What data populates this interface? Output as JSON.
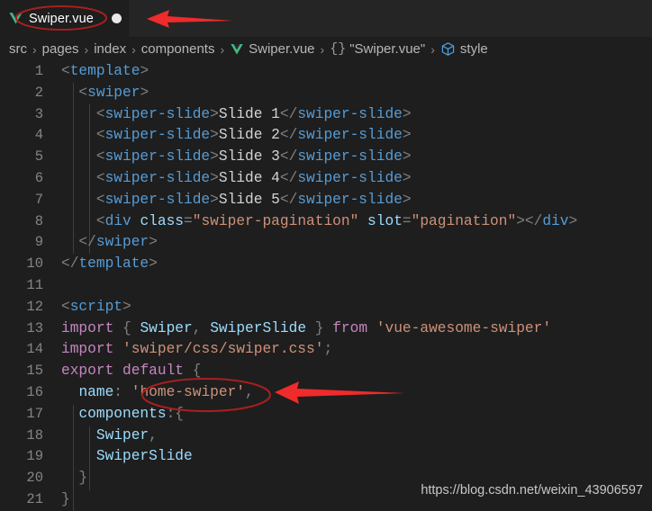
{
  "window": {
    "app": "Visual Studio Code",
    "theme_bg": "#1e1e1e",
    "tabbar_bg": "#252526"
  },
  "tabbar": {
    "tabs": [
      {
        "label": "Swiper.vue",
        "icon": "vue-icon",
        "dirty": true,
        "active": true
      }
    ]
  },
  "breadcrumb": {
    "separator": "›",
    "items": [
      {
        "label": "src",
        "icon": null
      },
      {
        "label": "pages",
        "icon": null
      },
      {
        "label": "index",
        "icon": null
      },
      {
        "label": "components",
        "icon": null
      },
      {
        "label": "Swiper.vue",
        "icon": "vue-icon"
      },
      {
        "label": "\"Swiper.vue\"",
        "icon": "braces-icon",
        "braces": "{}"
      },
      {
        "label": "style",
        "icon": "cube-icon"
      }
    ]
  },
  "editor": {
    "language": "vue",
    "first_line": 1,
    "lines": [
      {
        "n": "1",
        "tokens": [
          {
            "text": "<",
            "cls": "t-punct"
          },
          {
            "text": "template",
            "cls": "t-tag"
          },
          {
            "text": ">",
            "cls": "t-punct"
          }
        ]
      },
      {
        "n": "2",
        "tokens": [
          {
            "text": "  <",
            "cls": "t-punct"
          },
          {
            "text": "swiper",
            "cls": "t-tag"
          },
          {
            "text": ">",
            "cls": "t-punct"
          }
        ]
      },
      {
        "n": "3",
        "tokens": [
          {
            "text": "    <",
            "cls": "t-punct"
          },
          {
            "text": "swiper-slide",
            "cls": "t-tag"
          },
          {
            "text": ">",
            "cls": "t-punct"
          },
          {
            "text": "Slide 1",
            "cls": "t-text"
          },
          {
            "text": "</",
            "cls": "t-punct"
          },
          {
            "text": "swiper-slide",
            "cls": "t-tag"
          },
          {
            "text": ">",
            "cls": "t-punct"
          }
        ]
      },
      {
        "n": "4",
        "tokens": [
          {
            "text": "    <",
            "cls": "t-punct"
          },
          {
            "text": "swiper-slide",
            "cls": "t-tag"
          },
          {
            "text": ">",
            "cls": "t-punct"
          },
          {
            "text": "Slide 2",
            "cls": "t-text"
          },
          {
            "text": "</",
            "cls": "t-punct"
          },
          {
            "text": "swiper-slide",
            "cls": "t-tag"
          },
          {
            "text": ">",
            "cls": "t-punct"
          }
        ]
      },
      {
        "n": "5",
        "tokens": [
          {
            "text": "    <",
            "cls": "t-punct"
          },
          {
            "text": "swiper-slide",
            "cls": "t-tag"
          },
          {
            "text": ">",
            "cls": "t-punct"
          },
          {
            "text": "Slide 3",
            "cls": "t-text"
          },
          {
            "text": "</",
            "cls": "t-punct"
          },
          {
            "text": "swiper-slide",
            "cls": "t-tag"
          },
          {
            "text": ">",
            "cls": "t-punct"
          }
        ]
      },
      {
        "n": "6",
        "tokens": [
          {
            "text": "    <",
            "cls": "t-punct"
          },
          {
            "text": "swiper-slide",
            "cls": "t-tag"
          },
          {
            "text": ">",
            "cls": "t-punct"
          },
          {
            "text": "Slide 4",
            "cls": "t-text"
          },
          {
            "text": "</",
            "cls": "t-punct"
          },
          {
            "text": "swiper-slide",
            "cls": "t-tag"
          },
          {
            "text": ">",
            "cls": "t-punct"
          }
        ]
      },
      {
        "n": "7",
        "tokens": [
          {
            "text": "    <",
            "cls": "t-punct"
          },
          {
            "text": "swiper-slide",
            "cls": "t-tag"
          },
          {
            "text": ">",
            "cls": "t-punct"
          },
          {
            "text": "Slide 5",
            "cls": "t-text"
          },
          {
            "text": "</",
            "cls": "t-punct"
          },
          {
            "text": "swiper-slide",
            "cls": "t-tag"
          },
          {
            "text": ">",
            "cls": "t-punct"
          }
        ]
      },
      {
        "n": "8",
        "tokens": [
          {
            "text": "    <",
            "cls": "t-punct"
          },
          {
            "text": "div",
            "cls": "t-tag"
          },
          {
            "text": " ",
            "cls": "t-plain"
          },
          {
            "text": "class",
            "cls": "t-attr"
          },
          {
            "text": "=",
            "cls": "t-punct"
          },
          {
            "text": "\"swiper-pagination\"",
            "cls": "t-str"
          },
          {
            "text": " ",
            "cls": "t-plain"
          },
          {
            "text": "slot",
            "cls": "t-attr"
          },
          {
            "text": "=",
            "cls": "t-punct"
          },
          {
            "text": "\"pagination\"",
            "cls": "t-str"
          },
          {
            "text": ">",
            "cls": "t-punct"
          },
          {
            "text": "</",
            "cls": "t-punct"
          },
          {
            "text": "div",
            "cls": "t-tag"
          },
          {
            "text": ">",
            "cls": "t-punct"
          }
        ]
      },
      {
        "n": "9",
        "tokens": [
          {
            "text": "  </",
            "cls": "t-punct"
          },
          {
            "text": "swiper",
            "cls": "t-tag"
          },
          {
            "text": ">",
            "cls": "t-punct"
          }
        ]
      },
      {
        "n": "10",
        "tokens": [
          {
            "text": "</",
            "cls": "t-punct"
          },
          {
            "text": "template",
            "cls": "t-tag"
          },
          {
            "text": ">",
            "cls": "t-punct"
          }
        ]
      },
      {
        "n": "11",
        "tokens": []
      },
      {
        "n": "12",
        "tokens": [
          {
            "text": "<",
            "cls": "t-punct"
          },
          {
            "text": "script",
            "cls": "t-tag"
          },
          {
            "text": ">",
            "cls": "t-punct"
          }
        ]
      },
      {
        "n": "13",
        "tokens": [
          {
            "text": "import",
            "cls": "t-kw"
          },
          {
            "text": " ",
            "cls": "t-plain"
          },
          {
            "text": "{",
            "cls": "t-punct"
          },
          {
            "text": " ",
            "cls": "t-plain"
          },
          {
            "text": "Swiper",
            "cls": "t-id"
          },
          {
            "text": ", ",
            "cls": "t-punct"
          },
          {
            "text": "SwiperSlide",
            "cls": "t-id"
          },
          {
            "text": " ",
            "cls": "t-plain"
          },
          {
            "text": "}",
            "cls": "t-punct"
          },
          {
            "text": " ",
            "cls": "t-plain"
          },
          {
            "text": "from",
            "cls": "t-kw"
          },
          {
            "text": " ",
            "cls": "t-plain"
          },
          {
            "text": "'vue-awesome-swiper'",
            "cls": "t-str"
          }
        ]
      },
      {
        "n": "14",
        "tokens": [
          {
            "text": "import",
            "cls": "t-kw"
          },
          {
            "text": " ",
            "cls": "t-plain"
          },
          {
            "text": "'swiper/css/swiper.css'",
            "cls": "t-str"
          },
          {
            "text": ";",
            "cls": "t-punct"
          }
        ]
      },
      {
        "n": "15",
        "tokens": [
          {
            "text": "export",
            "cls": "t-kw"
          },
          {
            "text": " ",
            "cls": "t-plain"
          },
          {
            "text": "default",
            "cls": "t-kw"
          },
          {
            "text": " ",
            "cls": "t-plain"
          },
          {
            "text": "{",
            "cls": "t-punct"
          }
        ]
      },
      {
        "n": "16",
        "tokens": [
          {
            "text": "  ",
            "cls": "t-plain"
          },
          {
            "text": "name",
            "cls": "t-id"
          },
          {
            "text": ": ",
            "cls": "t-punct"
          },
          {
            "text": "'home-swiper'",
            "cls": "t-str"
          },
          {
            "text": ",",
            "cls": "t-punct"
          }
        ]
      },
      {
        "n": "17",
        "tokens": [
          {
            "text": "  ",
            "cls": "t-plain"
          },
          {
            "text": "components",
            "cls": "t-id"
          },
          {
            "text": ":{",
            "cls": "t-punct"
          }
        ]
      },
      {
        "n": "18",
        "tokens": [
          {
            "text": "    ",
            "cls": "t-plain"
          },
          {
            "text": "Swiper",
            "cls": "t-id"
          },
          {
            "text": ",",
            "cls": "t-punct"
          }
        ]
      },
      {
        "n": "19",
        "tokens": [
          {
            "text": "    ",
            "cls": "t-plain"
          },
          {
            "text": "SwiperSlide",
            "cls": "t-id"
          }
        ]
      },
      {
        "n": "20",
        "tokens": [
          {
            "text": "  }",
            "cls": "t-punct"
          }
        ]
      },
      {
        "n": "21",
        "tokens": [
          {
            "text": "}",
            "cls": "t-punct"
          }
        ]
      }
    ]
  },
  "annotations": {
    "color": "#ef2b2b",
    "ellipse_color": "#a81f1f",
    "items": [
      {
        "kind": "arrow",
        "name": "arrow-pointing-to-tab",
        "target": "Swiper.vue tab"
      },
      {
        "kind": "ellipse",
        "name": "ellipse-around-tab-title",
        "target": "Swiper.vue"
      },
      {
        "kind": "ellipse",
        "name": "ellipse-around-component-name",
        "target": "'home-swiper',"
      },
      {
        "kind": "arrow",
        "name": "arrow-pointing-to-component-name",
        "target": "'home-swiper',"
      }
    ]
  },
  "watermark": {
    "text": "https://blog.csdn.net/weixin_43906597"
  }
}
